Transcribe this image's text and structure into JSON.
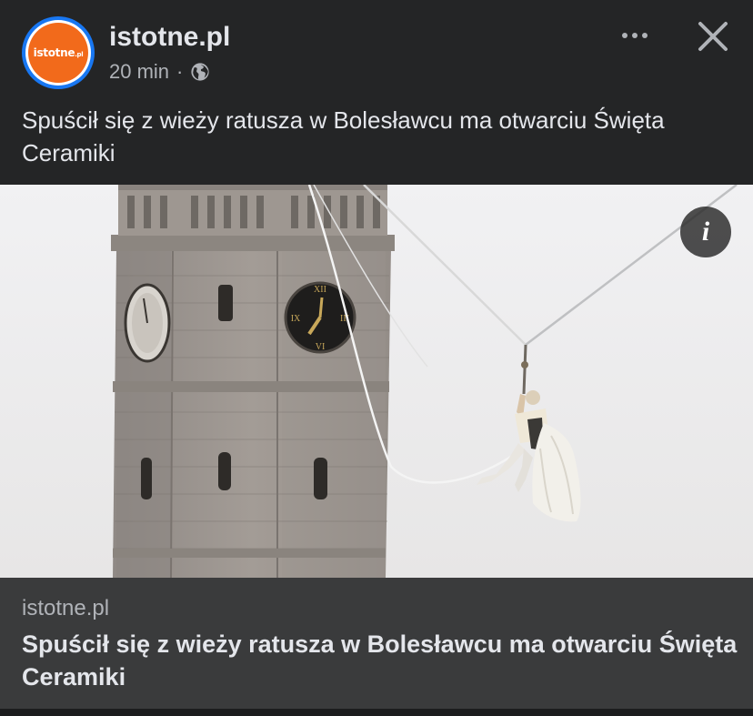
{
  "post": {
    "author": "istotne.pl",
    "avatar_text": "istotne",
    "avatar_suffix": ".pl",
    "time": "20 min",
    "separator": "·",
    "audience_icon": "globe-icon",
    "more_icon": "more-options-icon",
    "close_icon": "close-icon",
    "caption": "Spuścił się z wieży ratusza w Bolesławcu ma otwarciu Święta Ceramiki"
  },
  "photo": {
    "info_label": "i"
  },
  "link_preview": {
    "domain": "istotne.pl",
    "title": "Spuścił się z wieży ratusza w Bolesławcu ma otwarciu Święta Ceramiki"
  },
  "colors": {
    "background": "#242526",
    "preview_background": "#3a3b3c",
    "avatar_orange": "#f26a1b",
    "avatar_ring": "#1877f2"
  }
}
